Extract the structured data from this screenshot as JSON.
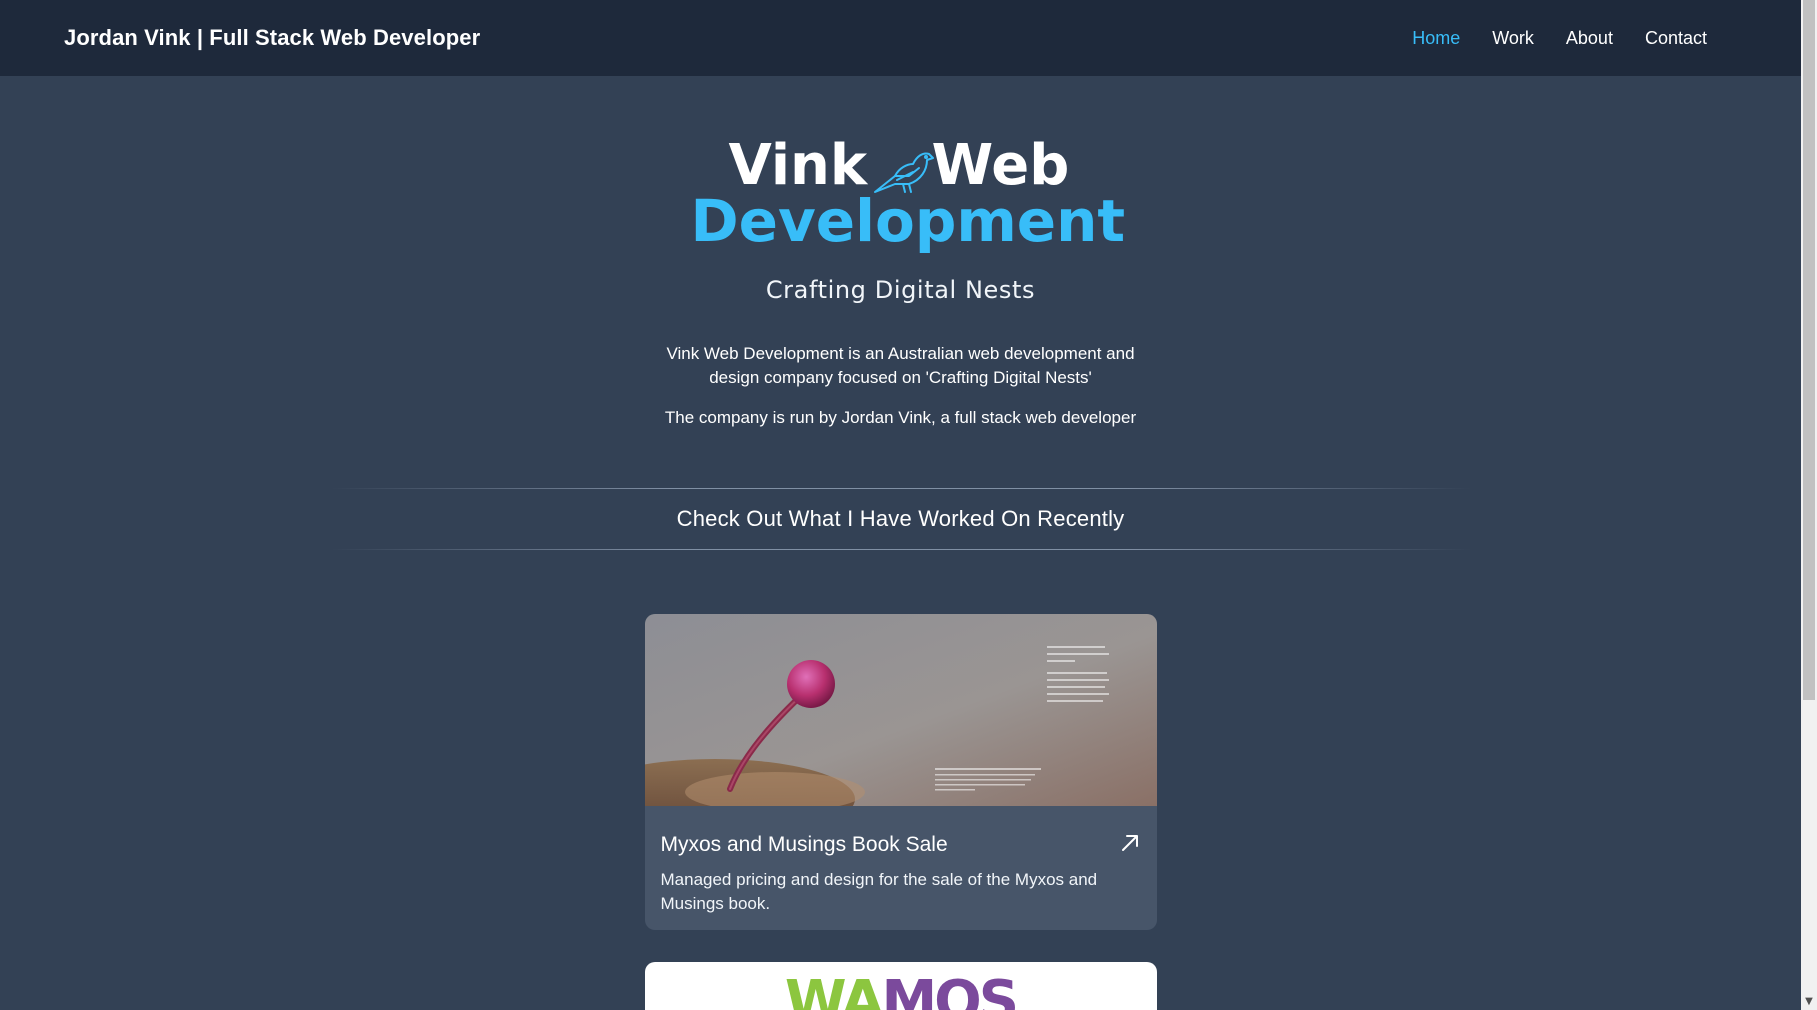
{
  "header": {
    "brand": "Jordan Vink | Full Stack Web Developer",
    "nav": [
      {
        "label": "Home",
        "active": true
      },
      {
        "label": "Work",
        "active": false
      },
      {
        "label": "About",
        "active": false
      },
      {
        "label": "Contact",
        "active": false
      }
    ]
  },
  "hero": {
    "logo_word1": "Vink",
    "logo_word2": "Web",
    "logo_word3": "Development",
    "logo_icon": "bird-icon",
    "tagline": "Crafting Digital Nests",
    "intro_1": "Vink Web Development is an Australian web development and design company focused on 'Crafting Digital Nests'",
    "intro_2": "The company is run by Jordan Vink, a full stack web developer"
  },
  "work": {
    "heading": "Check Out What I Have Worked On Recently",
    "projects": [
      {
        "title": "Myxos and Musings Book Sale",
        "description": "Managed pricing and design for the sale of the Myxos and Musings book.",
        "link_icon": "arrow-up-right-icon"
      },
      {
        "logo_text_a": "WA",
        "logo_text_b": "MOS"
      }
    ]
  },
  "colors": {
    "accent": "#38bdf8",
    "header_bg": "#1e293b",
    "page_bg": "#334155",
    "card_bg": "#475569"
  }
}
